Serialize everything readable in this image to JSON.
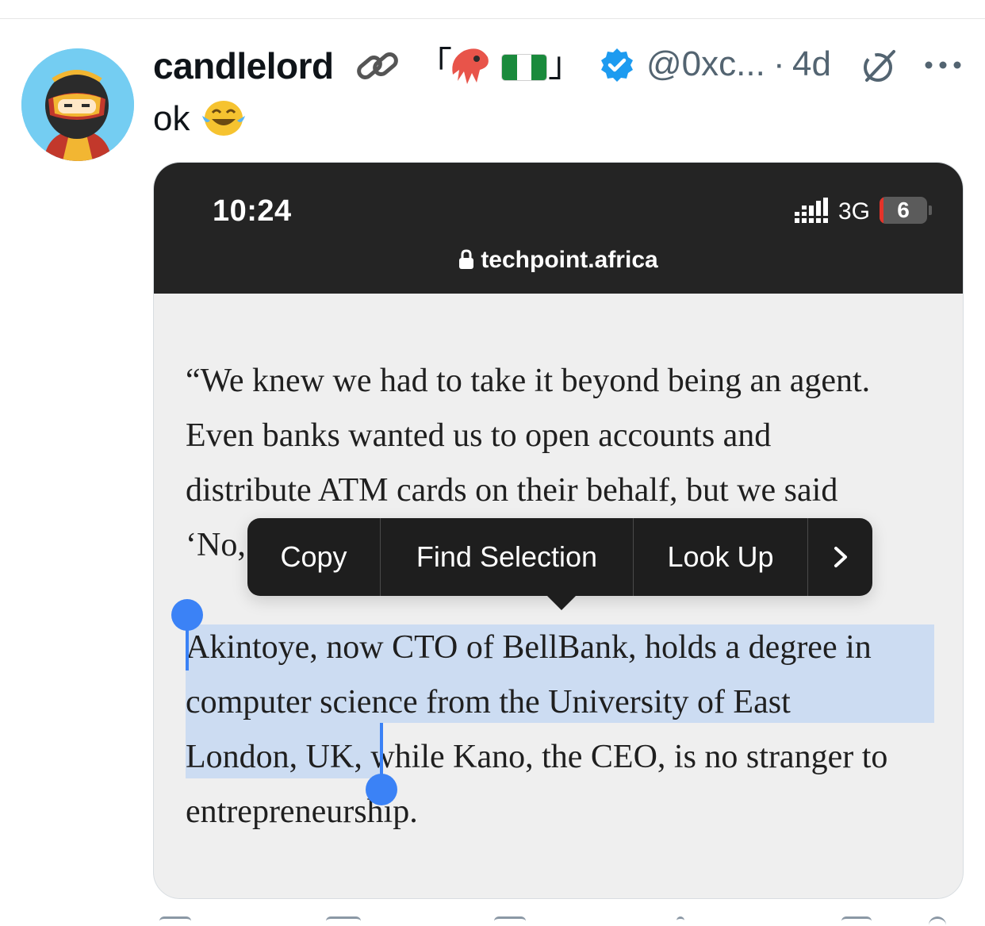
{
  "tweet": {
    "display_name": "candlelord",
    "name_decor_open": "「",
    "name_decor_close": "」",
    "handle": "@0xc...",
    "dot": "·",
    "timestamp": "4d",
    "text": "ok",
    "text_emoji_icon": "face-with-tears-of-joy-icon",
    "name_icons": [
      "link-icon",
      "squid-emoji-icon",
      "nigeria-flag-icon",
      "verified-badge-icon"
    ],
    "header_icons": [
      "grok-icon",
      "more-options-icon"
    ]
  },
  "screenshot": {
    "time": "10:24",
    "network": "3G",
    "battery": "6",
    "battery_level_percent": 6,
    "url": "techpoint.africa",
    "article": {
      "lines": [
        "“We knew we had to take it beyond being an agent.",
        "Even banks wanted us to open accounts and",
        "distribute ATM cards on their behalf, but we said",
        "‘No,"
      ],
      "selected_lines": [
        "Akintoye, now CTO of BellBank, holds a degree in",
        "computer science from the University of East",
        "London, UK,"
      ],
      "line_7_tail": " while Kano, the CEO, is no stranger to",
      "last_line": "entrepreneurship."
    },
    "context_menu": {
      "copy": "Copy",
      "find_selection": "Find Selection",
      "look_up": "Look Up",
      "more": "›"
    }
  },
  "colors": {
    "handle_gray": "#536471",
    "verified_blue": "#1d9bf0",
    "selection_blue": "#3b82f6",
    "selection_highlight": "#ccdcf2",
    "status_bar": "#242424"
  }
}
